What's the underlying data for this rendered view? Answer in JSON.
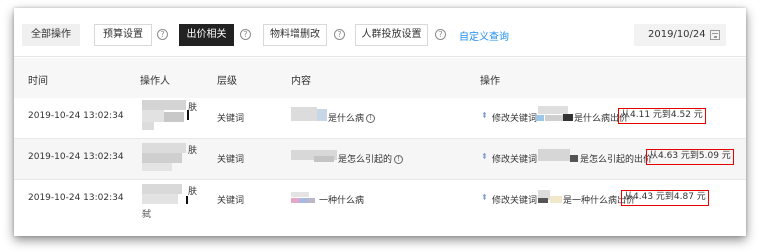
{
  "toolbar": {
    "tabs": [
      {
        "label": "全部操作"
      },
      {
        "label": "预算设置"
      },
      {
        "label": "出价相关"
      },
      {
        "label": "物料增删改"
      },
      {
        "label": "人群投放设置"
      }
    ],
    "help_glyph": "?",
    "custom_query": "自定义查询",
    "date": "2019/10/24",
    "icons": {
      "help": "help-circle-icon",
      "calendar": "calendar-icon"
    }
  },
  "table": {
    "headers": [
      "时间",
      "操作人",
      "层级",
      "内容",
      "操作"
    ],
    "rows": [
      {
        "time": "2019-10-24 13:02:34",
        "operator_suffix": "肤",
        "level": "关键词",
        "content": "是什么病",
        "action_prefix": "修改关键词",
        "action_mid": "是什么病出价",
        "change": "从4.11 元到4.52 元"
      },
      {
        "time": "2019-10-24 13:02:34",
        "operator_suffix": "肤",
        "level": "关键词",
        "content": "是怎么引起的",
        "action_prefix": "修改关键词",
        "action_mid": "是怎么引起的出价",
        "change": "从4.63 元到5.09 元"
      },
      {
        "time": "2019-10-24 13:02:34",
        "operator_suffix": "肤",
        "operator_extra": "弑",
        "level": "关键词",
        "content": "一种什么病",
        "action_prefix": "修改关键词",
        "action_mid": "是一种什么病出价",
        "change": "从4.43 元到4.87 元"
      }
    ],
    "info_glyph": "!"
  },
  "colors": {
    "active_tab": "#222222",
    "link": "#1f8ef1",
    "highlight_box": "#e60000"
  }
}
